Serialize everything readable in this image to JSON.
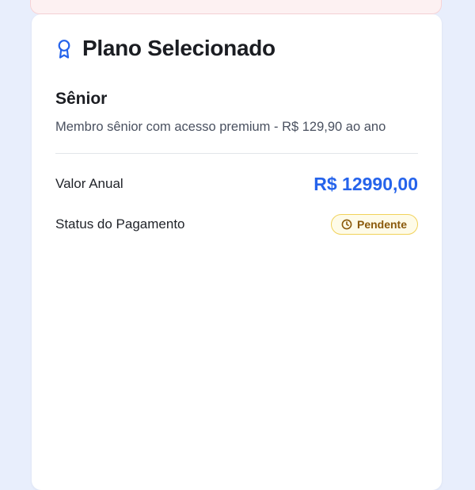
{
  "plan_card": {
    "title": "Plano Selecionado",
    "title_icon": "award-icon",
    "plan_name": "Sênior",
    "plan_description": "Membro sênior com acesso premium - R$ 129,90 ao ano",
    "annual": {
      "label": "Valor Anual",
      "amount": "R$ 12990,00"
    },
    "payment_status": {
      "label": "Status do Pagamento",
      "badge_label": "Pendente",
      "badge_icon": "clock-icon"
    }
  },
  "colors": {
    "page_background": "#e8eefc",
    "accent_blue": "#2563eb",
    "pending_badge_bg": "#fefbe8",
    "pending_badge_border": "#f1d25a",
    "pending_badge_text": "#8a5a0b",
    "top_card_bg": "#fdf1f2"
  }
}
